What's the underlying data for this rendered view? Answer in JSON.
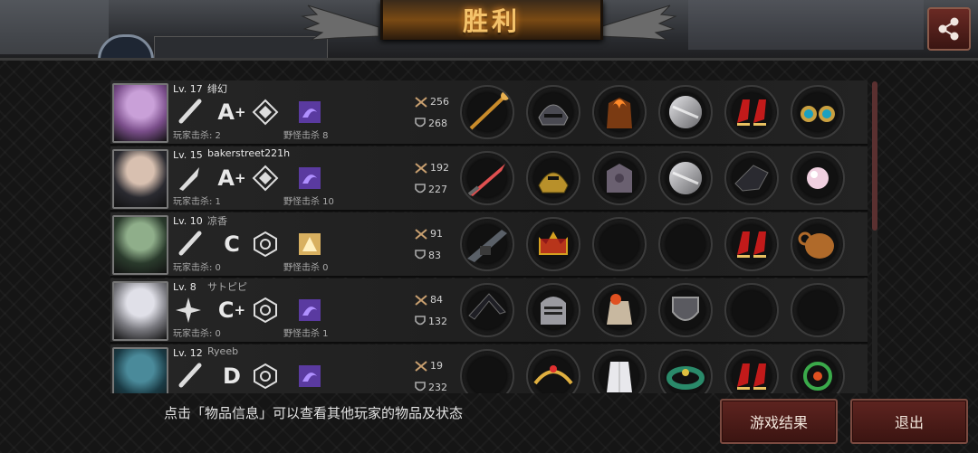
{
  "title": "胜利",
  "share_icon": "share-icon",
  "colors": {
    "accent": "#f4c26a",
    "button": "#5e2420",
    "row": "#262626"
  },
  "players": [
    {
      "level": "Lv. 17",
      "name": "绯幻",
      "name_dim": false,
      "weapon_icon": "bat-icon",
      "grade": "A",
      "grade_plus": "+",
      "tier_icon": "diamond-tier-icon",
      "trait_icon": "purple-trait-icon",
      "kills": "玩家击杀: 2",
      "monster_kills": "野怪击杀 8",
      "damage": "256",
      "defense": "268",
      "items": [
        "staff",
        "dark-helmet",
        "flame-armor",
        "silver-disc",
        "red-heels",
        "jewel-earrings"
      ]
    },
    {
      "level": "Lv. 15",
      "name": "bakerstreet221h",
      "name_dim": false,
      "weapon_icon": "knife-icon",
      "grade": "A",
      "grade_plus": "+",
      "tier_icon": "diamond-tier-icon",
      "trait_icon": "purple-trait-icon",
      "kills": "玩家击杀: 1",
      "monster_kills": "野怪击杀 10",
      "damage": "192",
      "defense": "227",
      "items": [
        "red-blade",
        "gold-helmet",
        "iron-armor",
        "silver-disc",
        "black-gauntlet",
        "pink-pearl"
      ]
    },
    {
      "level": "Lv. 10",
      "name": "凉香",
      "name_dim": true,
      "weapon_icon": "bat-icon",
      "grade": "C",
      "grade_plus": "",
      "tier_icon": "hex-tier-icon",
      "trait_icon": "gold-trait-icon",
      "kills": "玩家击杀: 0",
      "monster_kills": "野怪击杀 0",
      "damage": "91",
      "defense": "83",
      "items": [
        "rifle",
        "red-crown",
        "empty",
        "empty",
        "red-heels",
        "leather-pouch"
      ]
    },
    {
      "level": "Lv. 8",
      "name": "サトピピ",
      "name_dim": true,
      "weapon_icon": "shuriken-icon",
      "grade": "C",
      "grade_plus": "+",
      "tier_icon": "hex-tier-icon",
      "trait_icon": "purple-trait-icon",
      "kills": "玩家击杀: 0",
      "monster_kills": "野怪击杀 1",
      "damage": "84",
      "defense": "132",
      "items": [
        "boomerang",
        "knight-helmet",
        "cloth-armor",
        "iron-shield",
        "empty",
        "empty"
      ]
    },
    {
      "level": "Lv. 12",
      "name": "Ryeeb",
      "name_dim": true,
      "weapon_icon": "bat-icon",
      "grade": "D",
      "grade_plus": "",
      "tier_icon": "hex-tier-icon",
      "trait_icon": "purple-trait-icon",
      "kills": "",
      "monster_kills": "",
      "damage": "19",
      "defense": "232",
      "items": [
        "empty",
        "gold-tiara",
        "white-robe",
        "jade-bracelet",
        "red-heels",
        "green-ornament"
      ]
    }
  ],
  "hint": "点击「物品信息」可以查看其他玩家的物品及状态",
  "buttons": {
    "result": "游戏结果",
    "exit": "退出"
  }
}
